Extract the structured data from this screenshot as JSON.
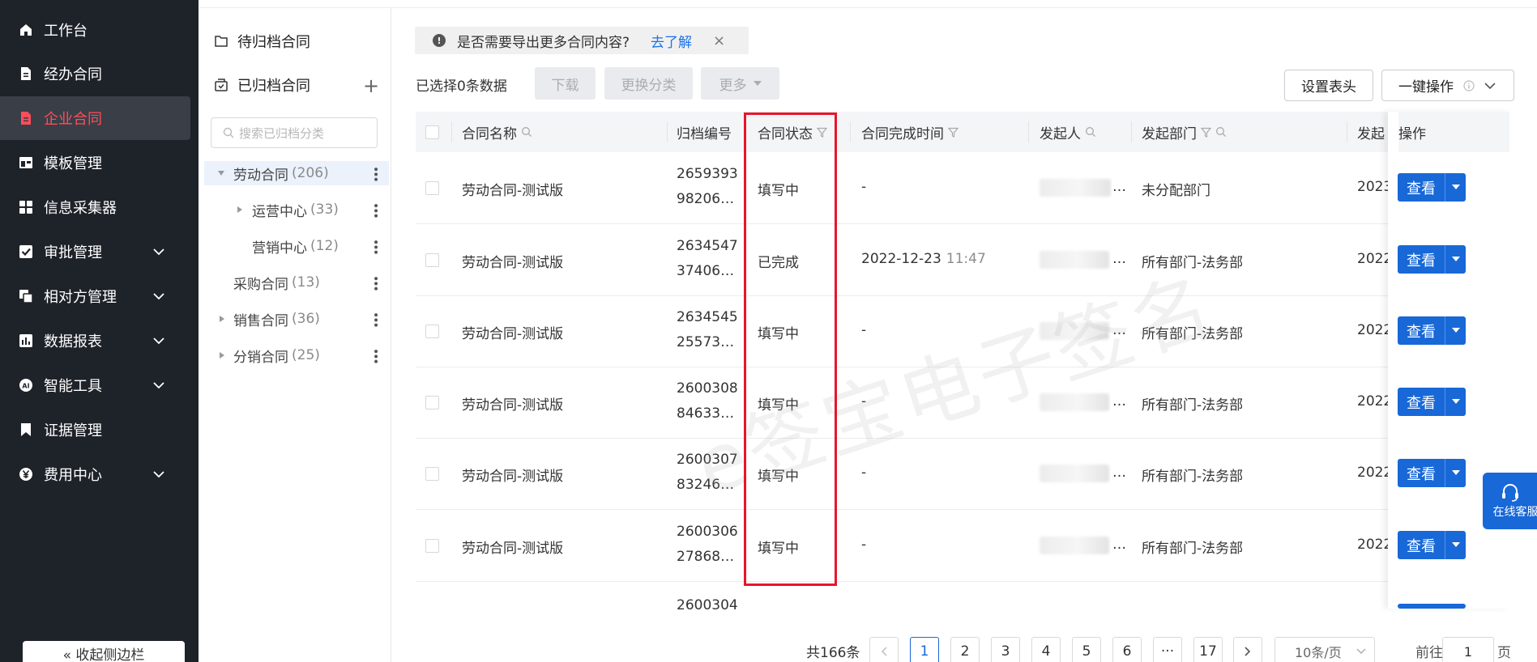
{
  "nav": {
    "items": [
      {
        "label": "工作台",
        "icon": "home-icon",
        "expand": false
      },
      {
        "label": "经办合同",
        "icon": "file-icon",
        "expand": false
      },
      {
        "label": "企业合同",
        "icon": "contract-icon",
        "expand": false,
        "active": true
      },
      {
        "label": "模板管理",
        "icon": "template-icon",
        "expand": false
      },
      {
        "label": "信息采集器",
        "icon": "grid-icon",
        "expand": false
      },
      {
        "label": "审批管理",
        "icon": "check-icon",
        "expand": true
      },
      {
        "label": "相对方管理",
        "icon": "copy-icon",
        "expand": true
      },
      {
        "label": "数据报表",
        "icon": "report-icon",
        "expand": true
      },
      {
        "label": "智能工具",
        "icon": "ai-icon",
        "expand": true
      },
      {
        "label": "证据管理",
        "icon": "bookmark-icon",
        "expand": false
      },
      {
        "label": "费用中心",
        "icon": "yen-icon",
        "expand": true
      }
    ],
    "collapse_label": "« 收起侧边栏"
  },
  "categories": {
    "pending_label": "待归档合同",
    "archived_label": "已归档合同",
    "search_placeholder": "搜索已归档分类",
    "tree": [
      {
        "label": "劳动合同",
        "count": "(206)",
        "selected": true
      },
      {
        "label": "运营中心",
        "count": "(33)"
      },
      {
        "label": "营销中心",
        "count": "(12)"
      },
      {
        "label": "采购合同",
        "count": "(13)"
      },
      {
        "label": "销售合同",
        "count": "(36)"
      },
      {
        "label": "分销合同",
        "count": "(25)"
      }
    ]
  },
  "notice": {
    "text": "是否需要导出更多合同内容?",
    "link": "去了解",
    "close": "×"
  },
  "toolbar": {
    "selected_info": "已选择0条数据",
    "download": "下载",
    "change_category": "更换分类",
    "more": "更多",
    "set_header": "设置表头",
    "one_click": "一键操作"
  },
  "table": {
    "headers": {
      "name": "合同名称",
      "archive_no": "归档编号",
      "status": "合同状态",
      "complete_time": "合同完成时间",
      "initiator": "发起人",
      "dept": "发起部门",
      "initiate_time": "发起",
      "action": "操作"
    },
    "rows": [
      {
        "name": "劳动合同-测试版",
        "no1": "2659393",
        "no2": "98206…",
        "status": "填写中",
        "time": "-",
        "time_sub": "",
        "initiator": "…",
        "dept": "未分配部门",
        "year": "2023"
      },
      {
        "name": "劳动合同-测试版",
        "no1": "2634547",
        "no2": "37406…",
        "status": "已完成",
        "time": "2022-12-23",
        "time_sub": "11:47",
        "initiator": "…",
        "dept": "所有部门-法务部",
        "year": "2022"
      },
      {
        "name": "劳动合同-测试版",
        "no1": "2634545",
        "no2": "25573…",
        "status": "填写中",
        "time": "-",
        "time_sub": "",
        "initiator": "…",
        "dept": "所有部门-法务部",
        "year": "2022"
      },
      {
        "name": "劳动合同-测试版",
        "no1": "2600308",
        "no2": "84633…",
        "status": "填写中",
        "time": "-",
        "time_sub": "",
        "initiator": "…",
        "dept": "所有部门-法务部",
        "year": "2022"
      },
      {
        "name": "劳动合同-测试版",
        "no1": "2600307",
        "no2": "83246…",
        "status": "填写中",
        "time": "-",
        "time_sub": "",
        "initiator": "…",
        "dept": "所有部门-法务部",
        "year": "2022"
      },
      {
        "name": "劳动合同-测试版",
        "no1": "2600306",
        "no2": "27868…",
        "status": "填写中",
        "time": "-",
        "time_sub": "",
        "initiator": "…",
        "dept": "所有部门-法务部",
        "year": "2022"
      }
    ],
    "partial_row": {
      "no1": "2600304"
    },
    "view_label": "查看"
  },
  "watermark": "e签宝电子签名",
  "pagination": {
    "total": "共166条",
    "pages": [
      "1",
      "2",
      "3",
      "4",
      "5",
      "6",
      "···",
      "17"
    ],
    "current": "1",
    "page_size": "10条/页",
    "goto_label": "前往",
    "goto_value": "1",
    "page_unit": "页"
  },
  "service": {
    "label": "在线客服"
  },
  "colors": {
    "accent": "#1868d8",
    "nav_bg": "#1e2229",
    "nav_active": "#ff4d5b",
    "highlight": "#e8152b"
  }
}
